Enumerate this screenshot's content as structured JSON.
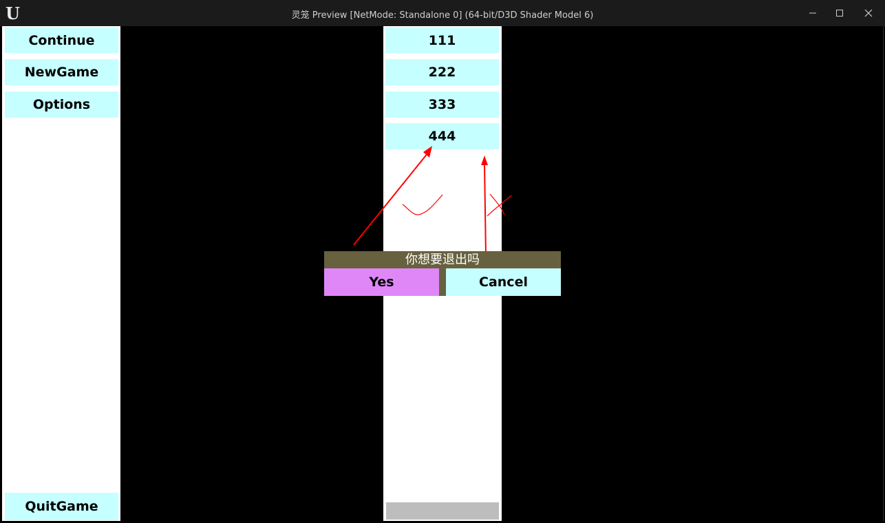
{
  "window": {
    "title": "灵笼 Preview [NetMode: Standalone 0]  (64-bit/D3D Shader Model 6)",
    "logo_icon": "unreal-engine-logo-icon",
    "minimize_icon": "minimize-icon",
    "maximize_icon": "maximize-icon",
    "close_icon": "close-icon"
  },
  "left_menu": {
    "continue_label": "Continue",
    "newgame_label": "NewGame",
    "options_label": "Options",
    "quitgame_label": "QuitGame"
  },
  "list": {
    "items": [
      "111",
      "222",
      "333",
      "444"
    ]
  },
  "dialog": {
    "title": "你想要退出吗",
    "yes_label": "Yes",
    "cancel_label": "Cancel"
  },
  "colors": {
    "button_bg": "#c6ffff",
    "yes_bg": "#e087f8",
    "dialog_bg": "#67613f",
    "annotation": "#ff0000"
  }
}
